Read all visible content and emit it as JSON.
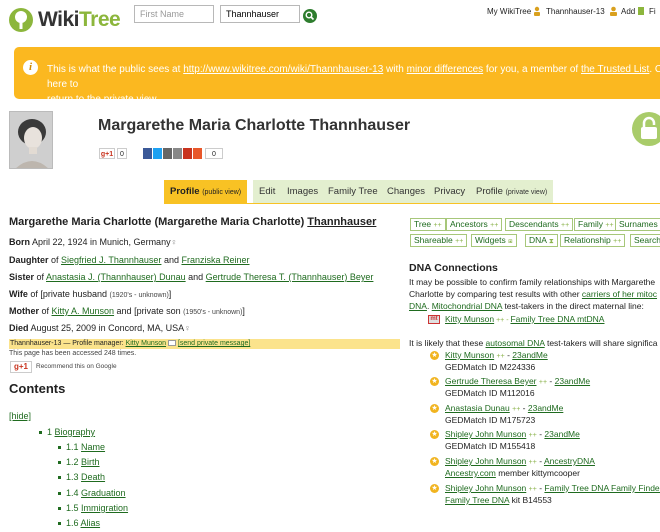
{
  "header": {
    "logo_left": "Wiki",
    "logo_right": "Tree",
    "first_name_placeholder": "First Name",
    "last_name_value": "Thannhauser",
    "my_wikitree": "My WikiTree",
    "current_user": "Thannhauser-13",
    "add_label": "Add",
    "find_label": "Fi"
  },
  "banner": {
    "text_1": "This is what the public sees at ",
    "url": "http://www.wikitree.com/wiki/Thannhauser-13",
    "text_2": " with ",
    "minor_differences": "minor differences",
    "text_3": " for you, a member of ",
    "trusted_list": "the Trusted List",
    "text_4": ". Click here to",
    "return_link": "return to the private view",
    "text_5": "."
  },
  "profile": {
    "name_title": "Margarethe Maria Charlotte Thannhauser",
    "gplus_count": "0",
    "share_count": "0"
  },
  "tabs": [
    {
      "label": "Profile",
      "sub": "(public view)"
    },
    {
      "label": "Edit"
    },
    {
      "label": "Images"
    },
    {
      "label": "Family Tree"
    },
    {
      "label": "Changes"
    },
    {
      "label": "Privacy"
    },
    {
      "label": "Profile",
      "sub": "(private view)"
    }
  ],
  "bio": {
    "full_name": "Margarethe Maria Charlotte (Margarethe Maria Charlotte) ",
    "surname": "Thannhauser",
    "born_label": "Born",
    "born_text": " April 22, 1924 in Munich, Germany",
    "daughter_label": "Daughter",
    "daughter_of": " of ",
    "father": "Siegfried J. Thannhauser",
    "and": " and ",
    "mother_name": "Franziska Reiner",
    "sister_label": "Sister",
    "sister_of": " of ",
    "sibling1": "Anastasia J. (Thannhauser) Dunau",
    "sibling_and": " and ",
    "sibling2": "Gertrude Theresa T. (Thannhauser) Beyer",
    "wife_label": "Wife",
    "wife_of": " of [private husband ",
    "wife_years": "(1920's - unknown)",
    "wife_close": "]",
    "mother_label": "Mother",
    "mother_of": " of ",
    "child1": "Kitty A. Munson",
    "child_and": " and [private son ",
    "child_years": "(1950's - unknown)",
    "child_close": "]",
    "died_label": "Died",
    "died_text": " August 25, 2009 in Concord, MA, USA",
    "manager_prefix": "Thannhauser-13 — Profile manager: ",
    "manager_name": "Kitty Munson",
    "manager_link": "[send private message]",
    "accessed": "This page has been accessed 248 times.",
    "gplus": "g+1",
    "recommend": "Recommend this on Google"
  },
  "contents": {
    "title": "Contents",
    "hide": "[hide]",
    "items": [
      {
        "num": "1",
        "label": "Biography"
      },
      {
        "num": "1.1",
        "label": "Name"
      },
      {
        "num": "1.2",
        "label": "Birth"
      },
      {
        "num": "1.3",
        "label": "Death"
      },
      {
        "num": "1.4",
        "label": "Graduation"
      },
      {
        "num": "1.5",
        "label": "Immigration"
      },
      {
        "num": "1.6",
        "label": "Alias"
      }
    ]
  },
  "tools": {
    "row1": [
      "Tree",
      "Ancestors",
      "Descendants",
      "Family",
      "Surnames"
    ],
    "row2": [
      "Shareable",
      "Widgets",
      "DNA",
      "Relationship",
      "Search"
    ]
  },
  "dna": {
    "title": "DNA Connections",
    "intro_1": "It may be possible to confirm family relationships with Margarethe",
    "intro_2": "Charlotte by comparing test results with other ",
    "intro_link": "carriers of her mitoc",
    "intro_3a": "DNA",
    "intro_3b": ". ",
    "intro_3c": "Mitochondrial DNA",
    "intro_3d": " test-takers in the direct maternal line:",
    "mt_icon": "mt",
    "mt_name": "Kitty Munson",
    "mt_sep": " ++ - ",
    "mt_test": "Family Tree DNA mtDNA",
    "auto_1": "It is likely that these ",
    "auto_link": "autosomal DNA",
    "auto_2": " test-takers will share significa",
    "testers": [
      {
        "name": "Kitty Munson",
        "test": "23andMe",
        "sub": "GEDMatch ID M224336"
      },
      {
        "name": "Gertrude Theresa Beyer",
        "test": "23andMe",
        "sub": "GEDMatch ID M112016"
      },
      {
        "name": "Anastasia Dunau",
        "test": "23andMe",
        "sub": "GEDMatch ID M175723"
      },
      {
        "name": "Shipley John Munson",
        "test": "23andMe",
        "sub": "GEDMatch ID M155418"
      },
      {
        "name": "Shipley John Munson",
        "test": "AncestryDNA",
        "sub_link": "Ancestry.com",
        "sub": " member kittymcooper"
      },
      {
        "name": "Shipley John Munson",
        "test": "Family Tree DNA Family Finder",
        "sub_link": "Family Tree DNA",
        "sub": " kit B14553"
      }
    ]
  }
}
